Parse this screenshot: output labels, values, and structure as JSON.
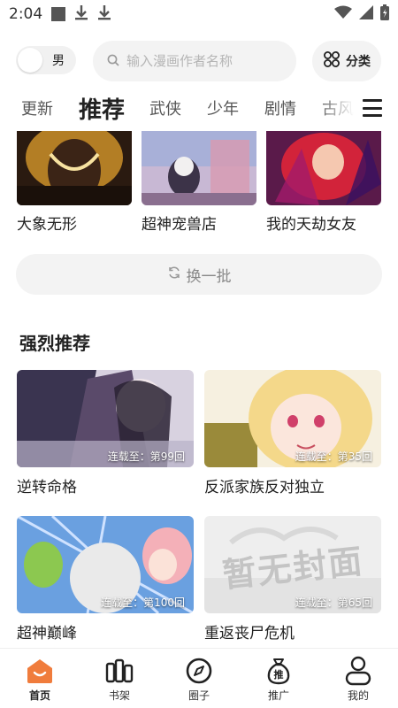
{
  "status": {
    "time": "2:04"
  },
  "search": {
    "gender_label": "男",
    "placeholder": "输入漫画作者名称",
    "category_label": "分类"
  },
  "tabs": [
    {
      "label": "更新",
      "active": false
    },
    {
      "label": "推荐",
      "active": true
    },
    {
      "label": "武侠",
      "active": false
    },
    {
      "label": "少年",
      "active": false
    },
    {
      "label": "剧情",
      "active": false
    },
    {
      "label": "古风",
      "active": false
    }
  ],
  "top_row": [
    {
      "title": "大象无形"
    },
    {
      "title": "超神宠兽店"
    },
    {
      "title": "我的天劫女友"
    }
  ],
  "refresh_label": "换一批",
  "section": {
    "title": "强烈推荐",
    "items": [
      {
        "title": "逆转命格",
        "badge": "连载至：第99回"
      },
      {
        "title": "反派家族反对独立",
        "badge": "连载至：第35回"
      },
      {
        "title": "超神巅峰",
        "badge": "连载至：第100回"
      },
      {
        "title": "重返丧尸危机",
        "badge": "连载至：第65回"
      }
    ]
  },
  "no_cover_text": "暂无封面",
  "nav": [
    {
      "label": "首页",
      "active": true
    },
    {
      "label": "书架",
      "active": false
    },
    {
      "label": "圈子",
      "active": false
    },
    {
      "label": "推广",
      "active": false
    },
    {
      "label": "我的",
      "active": false
    }
  ],
  "colors": {
    "accent": "#f07c3c",
    "bg_light": "#f3f3f3"
  }
}
